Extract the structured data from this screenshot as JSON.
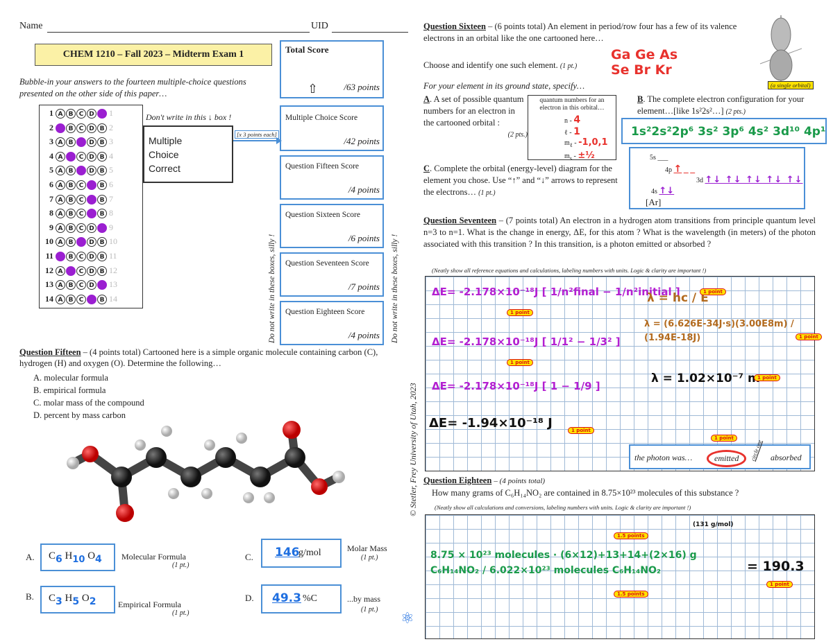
{
  "header": {
    "name_label": "Name",
    "uid_label": "UID"
  },
  "title": "CHEM 1210 – Fall 2023 – Midterm Exam 1",
  "instructions": "Bubble-in your answers to the fourteen multiple-choice questions presented on the other side of this paper…",
  "answer_sheet": {
    "choices": [
      "A",
      "B",
      "C",
      "D",
      "E"
    ],
    "rows": [
      {
        "num": "1",
        "filled": 4
      },
      {
        "num": "2",
        "filled": 0
      },
      {
        "num": "3",
        "filled": 2
      },
      {
        "num": "4",
        "filled": 1
      },
      {
        "num": "5",
        "filled": 2
      },
      {
        "num": "6",
        "filled": 3
      },
      {
        "num": "7",
        "filled": 3
      },
      {
        "num": "8",
        "filled": 3
      },
      {
        "num": "9",
        "filled": 4
      },
      {
        "num": "10",
        "filled": 2
      },
      {
        "num": "11",
        "filled": 0
      },
      {
        "num": "12",
        "filled": 1
      },
      {
        "num": "13",
        "filled": 4
      },
      {
        "num": "14",
        "filled": 3
      }
    ]
  },
  "dont_write": "Don't write in this ↓ box !",
  "mc_box_label": "Multiple Choice Correct",
  "points_each": "[x 3 points each]",
  "scores": {
    "total_label": "Total Score",
    "total_points": "/63 points",
    "mc_label": "Multiple Choice Score",
    "mc_points": "/42 points",
    "q15_label": "Question Fifteen Score",
    "q15_points": "/4 points",
    "q16_label": "Question Sixteen Score",
    "q16_points": "/6 points",
    "q17_label": "Question Seventeen Score",
    "q17_points": "/7 points",
    "q18_label": "Question Eighteen Score",
    "q18_points": "/4 points"
  },
  "side_note": "Do not write in these boxes, silly !",
  "copyright": "© Stetler, Frey University of Utah, 2023",
  "q15": {
    "title": "Question Fifteen",
    "intro": "– (4 points total) Cartooned here is a simple organic molecule containing carbon (C), hydrogen (H) and oxygen (O). Determine the following…",
    "items": [
      "A.  molecular formula",
      "B.  empirical formula",
      "C.  molar mass of the compound",
      "D.  percent by mass carbon"
    ],
    "a_label": "A.",
    "a_answer_c": "6",
    "a_answer_h": "10",
    "a_answer_o": "4",
    "a_caption": "Molecular Formula",
    "a_pt": "(1 pt.)",
    "b_label": "B.",
    "b_answer_c": "3",
    "b_answer_h": "5",
    "b_answer_o": "2",
    "b_caption": "Empirical Formula",
    "b_pt": "(1 pt.)",
    "c_label": "C.",
    "c_answer": "146",
    "c_unit": "g/mol",
    "c_caption": "Molar Mass",
    "c_pt": "(1 pt.)",
    "d_label": "D.",
    "d_answer": "49.3",
    "d_unit": "%C",
    "d_caption": "...by mass",
    "d_pt": "(1 pt.)"
  },
  "q16": {
    "title": "Question Sixteen",
    "intro": "– (6 points total) An element in period/row four has a few of its valence electrons in an orbital like the one cartooned here…",
    "choose": "Choose and identify one such element.",
    "choose_pt": "(1 pt.)",
    "answer_line1": "Ga Ge As",
    "answer_line2": "Se Br Kr",
    "orbital_caption": "(a single orbital)",
    "specify": "For your element in its ground state, specify…",
    "a_text": "A set of possible quantum numbers for an electron in the cartooned orbital :",
    "a_pt": "(2 pts.)",
    "qn_header": "quantum numbers for an electron in this orbital…",
    "qn_n": "4",
    "qn_l": "1",
    "qn_ml": "-1,0,1",
    "qn_ms": "±½",
    "b_text": "The complete electron configuration for your element…[like 1s²2s²…]",
    "b_pt": "(2 pts.)",
    "config": "1s²2s²2p⁶ 3s² 3p⁶ 4s² 3d¹⁰ 4p¹",
    "c_text": "Complete the orbital (energy-level) diagram for the element you chose. Use “↑” and “↓” arrows to represent the electrons…",
    "c_pt": "(1 pt.)",
    "core": "[Ar]"
  },
  "q17": {
    "title": "Question Seventeen",
    "intro": "– (7 points total) An electron in a hydrogen atom transitions from principle quantum level n=3 to n=1. What is the change in energy, ΔE, for this atom ? What is the wavelength (in meters) of the photon associated with this transition ? In this transition, is a photon emitted or absorbed ?",
    "note": "(Neatly show all reference equations and calculations, labeling numbers with units. Logic & clarity are important !)",
    "eq1": "ΔE= -2.178×10⁻¹⁸J [ 1/n²final − 1/n²initial ]",
    "eq2": "ΔE= -2.178×10⁻¹⁸J [ 1/1² − 1/3² ]",
    "eq3": "ΔE= -2.178×10⁻¹⁸J [ 1 − 1/9 ]",
    "eq4": "ΔE= -1.94×10⁻¹⁸ J",
    "lam1": "λ = hc / E",
    "lam2": "λ = (6.626E-34J·s)(3.00E8m) / (1.94E-18J)",
    "lam3": "λ = 1.02×10⁻⁷ m",
    "photon_label": "the photon was…",
    "emitted": "emitted",
    "circle_one": "circle one",
    "absorbed": "absorbed",
    "point_tag": "1 point"
  },
  "q18": {
    "title": "Question Eighteen",
    "intro": "– (4 points total)",
    "question": "How many grams of C₆H₁₄NO₂ are contained in 8.75×10²³ molecules of this substance ?",
    "note": "(Neatly show all calculations and conversions, labeling numbers with units. Logic & clarity are important !)",
    "work": "8.75 × 10²³ molecules · (6×12)+13+14+(2×16) g C₆H₁₄NO₂ / 6.022×10²³ molecules C₆H₁₄NO₂",
    "result": "= 190.3",
    "molar_note": "(131 g/mol)",
    "half_tag": "1.5 points",
    "point_tag": "1 point"
  }
}
